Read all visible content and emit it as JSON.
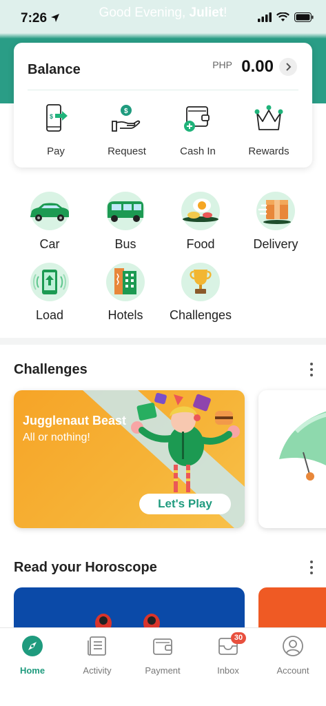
{
  "status_bar": {
    "time": "7:26",
    "greeting_prefix": "Good Evening, ",
    "greeting_name": "Juliet",
    "greeting_suffix": "!"
  },
  "balance": {
    "title": "Balance",
    "currency": "PHP",
    "amount": "0.00"
  },
  "quick_actions": [
    {
      "label": "Pay",
      "icon": "pay-phone-icon"
    },
    {
      "label": "Request",
      "icon": "request-hand-icon"
    },
    {
      "label": "Cash In",
      "icon": "wallet-plus-icon"
    },
    {
      "label": "Rewards",
      "icon": "crown-icon"
    }
  ],
  "services": [
    {
      "label": "Car",
      "icon": "car-icon"
    },
    {
      "label": "Bus",
      "icon": "bus-icon"
    },
    {
      "label": "Food",
      "icon": "food-icon"
    },
    {
      "label": "Delivery",
      "icon": "delivery-box-icon"
    },
    {
      "label": "Load",
      "icon": "phone-load-icon"
    },
    {
      "label": "Hotels",
      "icon": "hotel-icon"
    },
    {
      "label": "Challenges",
      "icon": "trophy-icon"
    }
  ],
  "challenges": {
    "section_title": "Challenges",
    "card": {
      "title": "Jugglenaut Beast",
      "subtitle": "All or nothing!",
      "button": "Let's Play"
    }
  },
  "horoscope": {
    "section_title": "Read your Horoscope"
  },
  "bottom_nav": [
    {
      "label": "Home",
      "icon": "compass-icon",
      "active": true
    },
    {
      "label": "Activity",
      "icon": "document-icon",
      "active": false
    },
    {
      "label": "Payment",
      "icon": "wallet-icon",
      "active": false
    },
    {
      "label": "Inbox",
      "icon": "inbox-icon",
      "active": false,
      "badge": "30"
    },
    {
      "label": "Account",
      "icon": "user-icon",
      "active": false
    }
  ],
  "colors": {
    "brand_green": "#1f9b7e",
    "header_teal": "#2a9d86",
    "service_circle": "#d9f3e4",
    "badge_red": "#e8503e",
    "challenge_orange": "#f6a427"
  }
}
